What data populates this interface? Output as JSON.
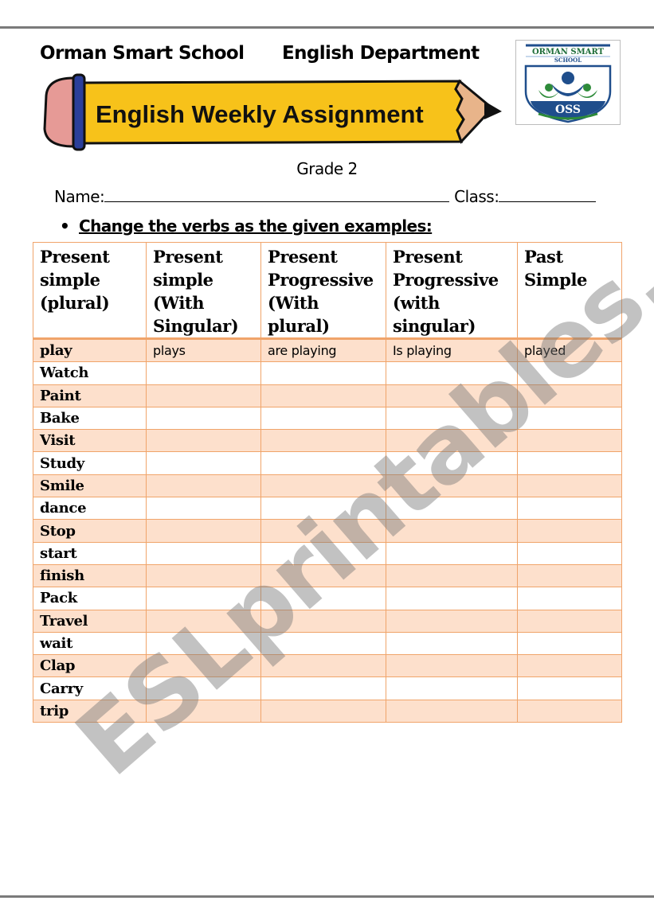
{
  "header": {
    "school_name": "Orman Smart School",
    "department": "English Department",
    "banner_title": "English Weekly Assignment",
    "logo": {
      "top_text": "ORMAN SMART",
      "sub_text": "SCHOOL",
      "initials": "OSS",
      "colors": {
        "blue": "#1f4e8c",
        "green": "#2e8b3a"
      }
    }
  },
  "grade": "Grade 2",
  "form": {
    "name_label": "Name:",
    "class_label": "Class:"
  },
  "instruction": "Change the verbs as the given examples:",
  "table": {
    "headers": [
      "Present simple (plural)",
      "Present simple (With Singular)",
      "Present Progressive (With plural)",
      "Present Progressive (with singular)",
      "Past Simple"
    ],
    "example": [
      "play",
      "plays",
      "are  playing",
      "Is playing",
      "played"
    ],
    "verbs": [
      "Watch",
      "Paint",
      "Bake",
      "Visit",
      "Study",
      "Smile",
      "dance",
      "Stop",
      "start",
      "finish",
      "Pack",
      "Travel",
      "wait",
      "Clap",
      "Carry",
      "trip"
    ]
  },
  "watermark": "ESLprintables.com",
  "colors": {
    "border": "#f0a46a",
    "shade": "#fde0cc",
    "pencil_yellow": "#f7c21a",
    "eraser_pink": "#e69a96"
  }
}
